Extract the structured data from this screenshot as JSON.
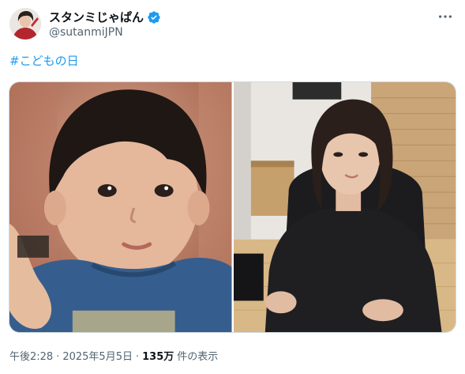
{
  "author": {
    "display_name": "スタンミじゃぱん",
    "handle": "@sutanmiJPN",
    "verified": true
  },
  "tweet": {
    "hashtag": "#こどもの日"
  },
  "media": {
    "photos": [
      {
        "label": "childhood photo of boy in blue sweater"
      },
      {
        "label": "adult man in black sweater sitting in gaming chair"
      }
    ]
  },
  "meta": {
    "time": "午後2:28",
    "separator1": "·",
    "date": "2025年5月5日",
    "separator2": "·",
    "views_count": "135万",
    "views_label": "件の表示"
  },
  "colors": {
    "accent": "#1d9bf0",
    "secondary_text": "#536471",
    "border": "#cfd9de"
  }
}
